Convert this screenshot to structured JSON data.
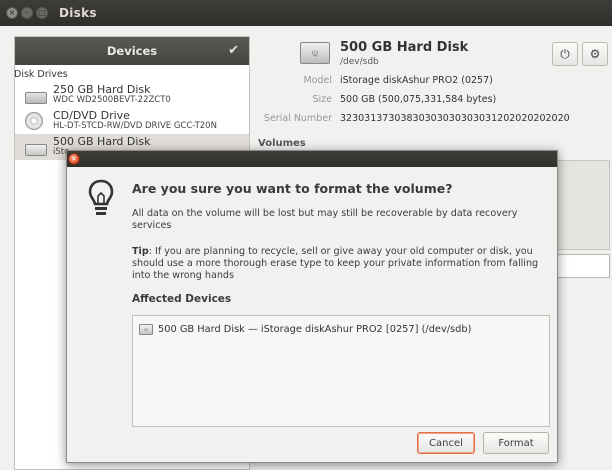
{
  "window": {
    "title": "Disks"
  },
  "sidebar": {
    "header": "Devices",
    "section_label": "Disk Drives",
    "items": [
      {
        "name": "250 GB Hard Disk",
        "sub": "WDC WD2500BEVT-22ZCT0",
        "icon": "hdd-icon"
      },
      {
        "name": "CD/DVD Drive",
        "sub": "HL-DT-STCD-RW/DVD DRIVE GCC-T20N",
        "icon": "disc-icon"
      },
      {
        "name": "500 GB Hard Disk",
        "sub": "iSto",
        "icon": "usb-drive-icon"
      }
    ]
  },
  "detail": {
    "title": "500 GB Hard Disk",
    "subtitle": "/dev/sdb",
    "fields": [
      {
        "label": "Model",
        "value": "iStorage diskAshur PRO2 (0257)"
      },
      {
        "label": "Size",
        "value": "500 GB (500,075,331,584 bytes)"
      },
      {
        "label": "Serial Number",
        "value": "32303137303830303030303031202020202020"
      }
    ],
    "volumes_label": "Volumes"
  },
  "dialog": {
    "heading": "Are you sure you want to format the volume?",
    "body": "All data on the volume will be lost but may still be recoverable by data recovery services",
    "tip_label": "Tip",
    "tip_text": ": If you are planning to recycle, sell or give away your old computer or disk, you should use a more thorough erase type to keep your private information from falling into the wrong hands",
    "affected_label": "Affected Devices",
    "affected_devices": [
      {
        "text": "500 GB Hard Disk — iStorage diskAshur PRO2 [0257] (/dev/sdb)"
      }
    ],
    "cancel_label": "Cancel",
    "format_label": "Format"
  }
}
